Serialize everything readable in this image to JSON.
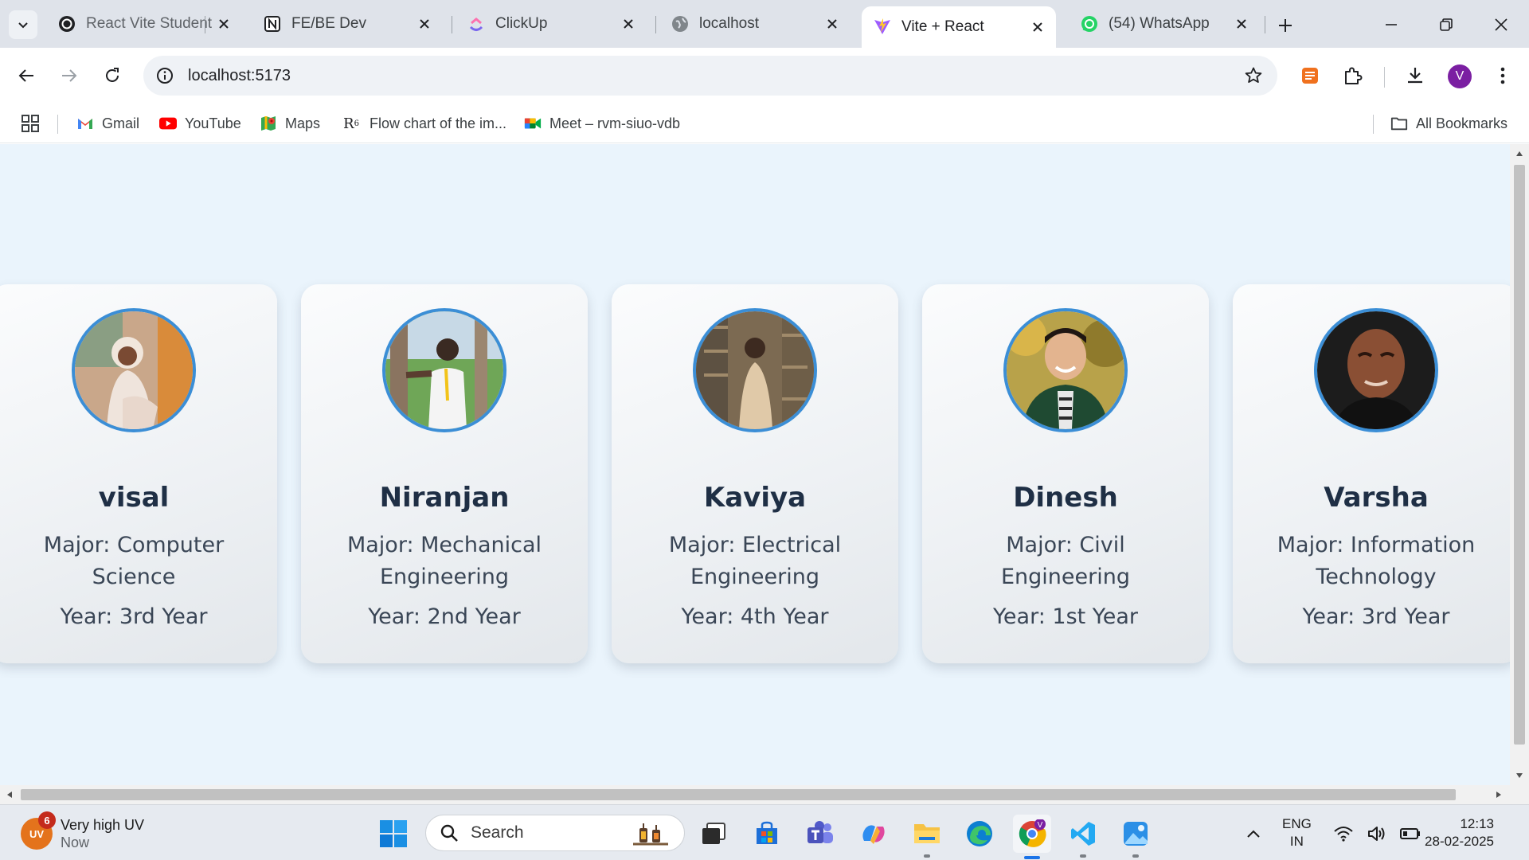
{
  "browser": {
    "tabs": [
      {
        "title": "React Vite Student",
        "favicon": "openai-icon",
        "active": false
      },
      {
        "title": "FE/BE Dev",
        "favicon": "notion-icon",
        "active": false
      },
      {
        "title": "ClickUp",
        "favicon": "clickup-icon",
        "active": false
      },
      {
        "title": "localhost",
        "favicon": "globe-icon",
        "active": false
      },
      {
        "title": "Vite + React",
        "favicon": "vite-icon",
        "active": true
      },
      {
        "title": "(54) WhatsApp",
        "favicon": "whatsapp-icon",
        "active": false
      }
    ],
    "url": "localhost:5173",
    "profile_initial": "V"
  },
  "bookmarks": {
    "items": [
      {
        "label": "Gmail",
        "icon": "gmail-icon"
      },
      {
        "label": "YouTube",
        "icon": "youtube-icon"
      },
      {
        "label": "Maps",
        "icon": "maps-icon"
      },
      {
        "label": "Flow chart of the im...",
        "icon": "r6-icon"
      },
      {
        "label": "Meet – rvm-siuo-vdb",
        "icon": "meet-icon"
      }
    ],
    "all_bookmarks": "All Bookmarks"
  },
  "students": [
    {
      "name": "visal",
      "major": "Major: Computer Science",
      "year": "Year: 3rd Year"
    },
    {
      "name": "Niranjan",
      "major": "Major: Mechanical Engineering",
      "year": "Year: 2nd Year"
    },
    {
      "name": "Kaviya",
      "major": "Major: Electrical Engineering",
      "year": "Year: 4th Year"
    },
    {
      "name": "Dinesh",
      "major": "Major: Civil Engineering",
      "year": "Year: 1st Year"
    },
    {
      "name": "Varsha",
      "major": "Major: Information Technology",
      "year": "Year: 3rd Year"
    }
  ],
  "taskbar": {
    "weather": {
      "title": "Very high UV",
      "subtitle": "Now",
      "badge": "UV",
      "count": "6"
    },
    "search_placeholder": "Search",
    "apps": [
      "file-explorer-icon-dark",
      "microsoft-store-icon",
      "teams-icon",
      "copilot-icon",
      "file-explorer-icon",
      "edge-icon",
      "chrome-icon",
      "vscode-icon",
      "photos-icon"
    ],
    "language": {
      "line1": "ENG",
      "line2": "IN"
    },
    "time": "12:13",
    "date": "28-02-2025"
  },
  "colors": {
    "accent": "#3b8ed6",
    "page_background": "#eaf4fc",
    "card_text": "#1f2f45"
  }
}
